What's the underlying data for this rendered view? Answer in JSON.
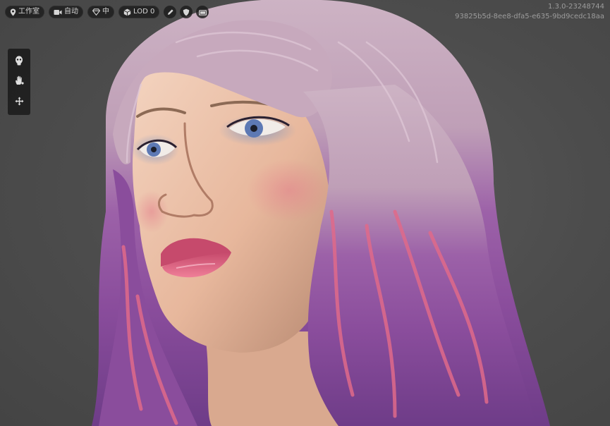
{
  "toolbar": {
    "location_label": "工作室",
    "camera_label": "自动",
    "quality_label": "中",
    "lod_label": "LOD 0"
  },
  "build": {
    "version": "1.3.0-23248744",
    "hash": "93825b5d-8ee8-dfa5-e635-9bd9cedc18aa"
  },
  "icons": {
    "location": "map-pin-icon",
    "camera": "video-camera-icon",
    "quality": "diamond-icon",
    "lod": "cube-icon",
    "pen": "pen-icon",
    "shield": "shield-icon",
    "screen": "monitor-icon",
    "face": "face-icon",
    "hand": "hand-icon",
    "move": "move-arrows-icon"
  },
  "colors": {
    "background": "#4b4b4b",
    "pill": "#1c1c1c",
    "text": "#d6d6d6",
    "skin": "#e8b89e",
    "hair_top": "#c9aec0",
    "hair_mid": "#9a5fa5",
    "hair_tips": "#d96a8a",
    "lips": "#d8587a",
    "eyes": "#5d79b4"
  }
}
